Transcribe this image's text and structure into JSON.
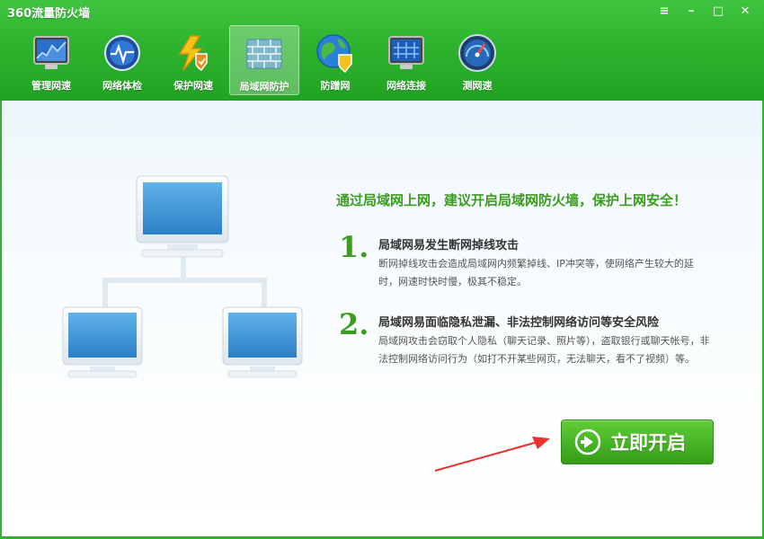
{
  "window": {
    "title": "360流量防火墙",
    "controls": [
      "≡",
      "–",
      "□",
      "✕"
    ]
  },
  "toolbar": {
    "items": [
      {
        "label": "管理网速",
        "icon": "speed-monitor-icon",
        "active": false
      },
      {
        "label": "网络体检",
        "icon": "network-checkup-icon",
        "active": false
      },
      {
        "label": "保护网速",
        "icon": "protect-speed-icon",
        "active": false
      },
      {
        "label": "局域网防护",
        "icon": "lan-firewall-icon",
        "active": true
      },
      {
        "label": "防蹭网",
        "icon": "anti-leech-globe-icon",
        "active": false
      },
      {
        "label": "网络连接",
        "icon": "network-connection-icon",
        "active": false
      },
      {
        "label": "测网速",
        "icon": "speed-test-gauge-icon",
        "active": false
      }
    ]
  },
  "main": {
    "headline": "通过局域网上网，建议开启局域网防火墙，保护上网安全！",
    "points": [
      {
        "num": "1.",
        "title": "局域网易发生断网掉线攻击",
        "desc": "断网掉线攻击会造成局域网内频繁掉线、IP冲突等，使网络产生较大的延时，网速时快时慢，极其不稳定。"
      },
      {
        "num": "2.",
        "title": "局域网易面临隐私泄漏、非法控制网络访问等安全风险",
        "desc": "局域网攻击会窃取个人隐私（聊天记录、照片等），盗取银行或聊天帐号，非法控制网络访问行为（如打不开某些网页，无法聊天，看不了视频）等。"
      }
    ],
    "start_button": "立即开启"
  },
  "colors": {
    "brand_green": "#2fb530",
    "headline_green": "#3b9c1e",
    "arrow_red": "#e8312b"
  }
}
